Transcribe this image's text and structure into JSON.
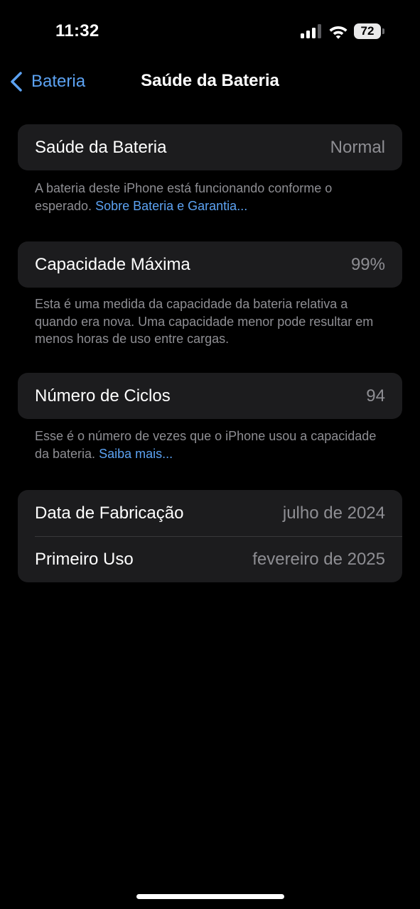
{
  "status_bar": {
    "time": "11:32",
    "battery_level": "72",
    "signal_icon": "cellular-signal-icon",
    "wifi_icon": "wifi-icon",
    "battery_icon": "battery-icon"
  },
  "nav": {
    "back_label": "Bateria",
    "back_icon": "chevron-left-icon",
    "title": "Saúde da Bateria"
  },
  "health": {
    "label": "Saúde da Bateria",
    "value": "Normal",
    "note": "A bateria deste iPhone está funcionando conforme o esperado.",
    "link": "Sobre Bateria e Garantia..."
  },
  "capacity": {
    "label": "Capacidade Máxima",
    "value": "99%",
    "note": "Esta é uma medida da capacidade da bateria relativa a quando era nova. Uma capacidade menor pode resultar em menos horas de uso entre cargas."
  },
  "cycles": {
    "label": "Número de Ciclos",
    "value": "94",
    "note": "Esse é o número de vezes que o iPhone usou a capacidade da bateria.",
    "link": "Saiba mais..."
  },
  "dates": {
    "manufacture_label": "Data de Fabricação",
    "manufacture_value": "julho de 2024",
    "first_use_label": "Primeiro Uso",
    "first_use_value": "fevereiro de 2025"
  },
  "colors": {
    "background": "#000000",
    "cell_background": "#1c1c1e",
    "accent": "#5ca2f2",
    "secondary_text": "#8e8e93"
  }
}
